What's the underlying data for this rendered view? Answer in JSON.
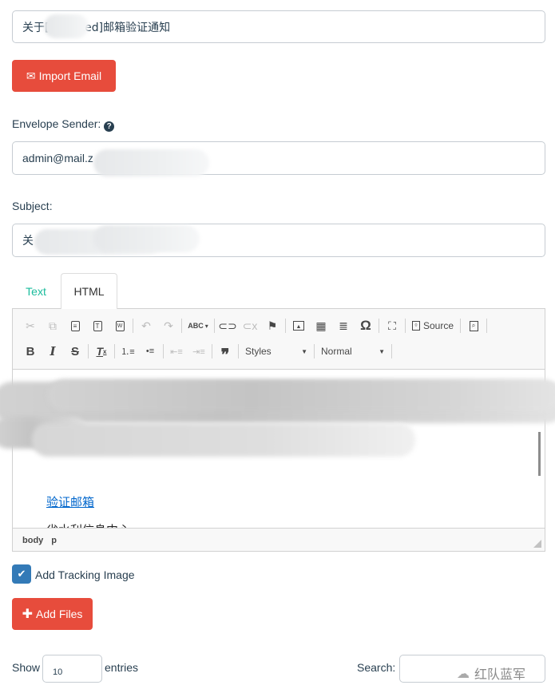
{
  "template_name": {
    "value_visible": "关于[redacted]邮箱验证通知"
  },
  "import_email_button": {
    "label": "Import Email",
    "icon": "envelope-icon"
  },
  "envelope_sender": {
    "label": "Envelope Sender:",
    "help_icon": "question-circle-icon",
    "value_visible": "admin@mail.z"
  },
  "subject": {
    "label": "Subject:",
    "value_visible": "关"
  },
  "tabs": [
    {
      "label": "Text",
      "active": false
    },
    {
      "label": "HTML",
      "active": true
    }
  ],
  "editor": {
    "toolbar_row1": [
      {
        "name": "cut-icon",
        "glyph": "✂",
        "enabled": false
      },
      {
        "name": "copy-icon",
        "glyph": "⧉",
        "enabled": false
      },
      {
        "name": "paste-icon",
        "glyph": "📋",
        "enabled": true
      },
      {
        "name": "paste-text-icon",
        "glyph": "T",
        "enabled": true
      },
      {
        "name": "paste-word-icon",
        "glyph": "W",
        "enabled": true
      },
      {
        "name": "undo-icon",
        "glyph": "↶",
        "enabled": false
      },
      {
        "name": "redo-icon",
        "glyph": "↷",
        "enabled": false
      },
      {
        "name": "spellcheck-icon",
        "glyph": "ABC✓",
        "enabled": true
      },
      {
        "name": "link-icon",
        "glyph": "🔗",
        "enabled": true
      },
      {
        "name": "unlink-icon",
        "glyph": "⛓",
        "enabled": false
      },
      {
        "name": "anchor-flag-icon",
        "glyph": "⚑",
        "enabled": true
      },
      {
        "name": "image-icon",
        "glyph": "🖼",
        "enabled": true
      },
      {
        "name": "table-icon",
        "glyph": "▦",
        "enabled": true
      },
      {
        "name": "horizontal-rule-icon",
        "glyph": "≣",
        "enabled": true
      },
      {
        "name": "special-char-icon",
        "glyph": "Ω",
        "enabled": true
      },
      {
        "name": "maximize-icon",
        "glyph": "⛶",
        "enabled": true
      }
    ],
    "source_label": "Source",
    "toolbar_row2": [
      {
        "name": "bold-icon",
        "glyph": "B"
      },
      {
        "name": "italic-icon",
        "glyph": "I"
      },
      {
        "name": "strike-icon",
        "glyph": "S"
      },
      {
        "name": "remove-format-icon",
        "glyph": "Tx"
      },
      {
        "name": "numbered-list-icon",
        "glyph": "1≡"
      },
      {
        "name": "bulleted-list-icon",
        "glyph": "•≡"
      },
      {
        "name": "outdent-icon",
        "glyph": "⇤"
      },
      {
        "name": "indent-icon",
        "glyph": "⇥"
      },
      {
        "name": "blockquote-icon",
        "glyph": "❞"
      }
    ],
    "styles_combo": "Styles",
    "format_combo": "Normal",
    "content_link": "验证邮箱",
    "content_cut_line": "省水利信息中心",
    "path": [
      "body",
      "p"
    ]
  },
  "tracking": {
    "label": "Add Tracking Image",
    "checked": true
  },
  "add_files_button": {
    "label": "Add Files",
    "icon": "plus-icon"
  },
  "table_controls": {
    "show_label": "Show",
    "page_length": "10",
    "entries_label": "entries",
    "search_label": "Search:",
    "search_value": ""
  },
  "watermark": "红队蓝军",
  "colors": {
    "danger": "#e74c3c",
    "primary": "#337ab7",
    "teal": "#1abc9c",
    "text": "#283f50",
    "link": "#0066cc"
  }
}
